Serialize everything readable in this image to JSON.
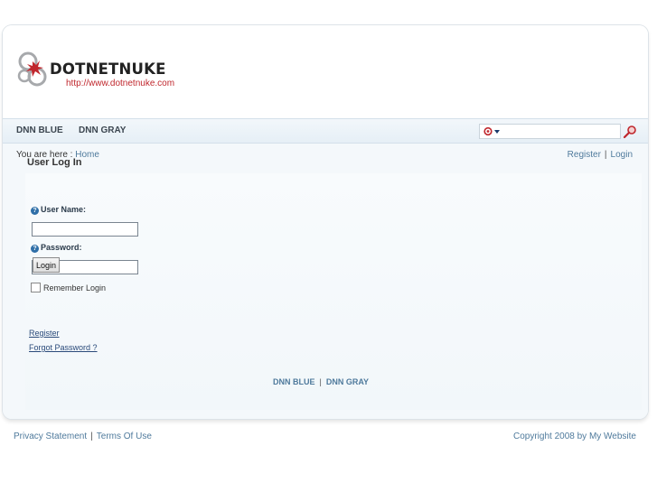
{
  "logo": {
    "name": "DOTNETNUKE",
    "url": "http://www.dotnetnuke.com"
  },
  "nav": {
    "items": [
      {
        "label": "DNN BLUE"
      },
      {
        "label": "DNN GRAY"
      }
    ]
  },
  "search": {
    "value": "",
    "placeholder": ""
  },
  "breadcrumb": {
    "prefix": "You are here :",
    "current": "Home"
  },
  "user_links": {
    "register": "Register",
    "separator": "|",
    "login": "Login"
  },
  "login_module": {
    "title": "User Log In",
    "username_label": "User Name:",
    "password_label": "Password:",
    "username_value": "",
    "password_value": "",
    "login_button": "Login",
    "remember_label": "Remember Login",
    "register_link": "Register",
    "forgot_link": "Forgot Password ?"
  },
  "bottom_nav": {
    "items": [
      "DNN BLUE",
      "DNN GRAY"
    ],
    "separator": "|"
  },
  "footer": {
    "privacy": "Privacy Statement",
    "separator": "|",
    "terms": "Terms Of Use",
    "copyright": "Copyright 2008 by My Website"
  },
  "colors": {
    "link": "#4f7a9c",
    "brand_red": "#c0272d",
    "help_icon": "#2f6fa8"
  }
}
